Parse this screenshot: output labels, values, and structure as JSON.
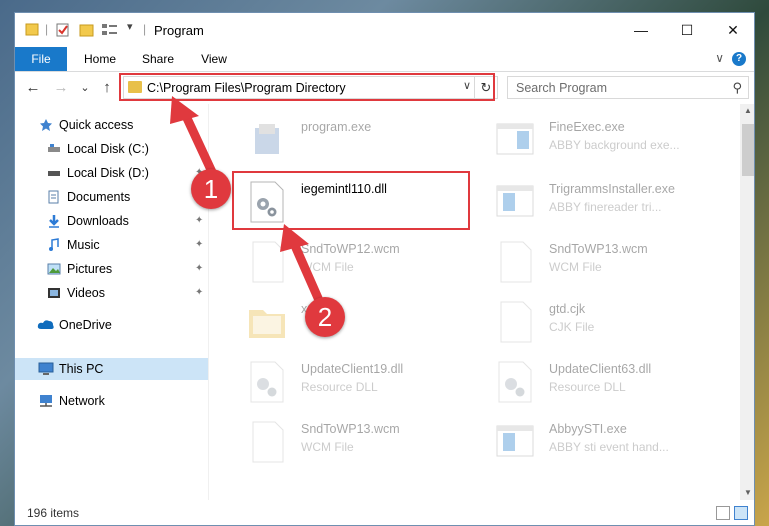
{
  "window": {
    "title": "Program",
    "minimize": "—",
    "maximize": "☐",
    "close": "✕"
  },
  "ribbon": {
    "tabs": [
      "File",
      "Home",
      "Share",
      "View"
    ],
    "help": "?",
    "collapse": "∨"
  },
  "nav": {
    "back": "←",
    "forward": "→",
    "recent": "⌄",
    "up": "↑",
    "address": "C:\\Program Files\\Program Directory",
    "address_dropdown": "∨",
    "refresh": "↻",
    "search_placeholder": "Search Program",
    "search_icon": "⚲"
  },
  "sidebar": {
    "items": [
      {
        "label": "Quick access",
        "icon": "star-icon",
        "pinned": false
      },
      {
        "label": "Local Disk (C:)",
        "icon": "drive-icon",
        "pinned": true
      },
      {
        "label": "Local Disk (D:)",
        "icon": "drive-icon",
        "pinned": true
      },
      {
        "label": "Documents",
        "icon": "documents-icon",
        "pinned": true
      },
      {
        "label": "Downloads",
        "icon": "downloads-icon",
        "pinned": true
      },
      {
        "label": "Music",
        "icon": "music-icon",
        "pinned": true
      },
      {
        "label": "Pictures",
        "icon": "pictures-icon",
        "pinned": true
      },
      {
        "label": "Videos",
        "icon": "videos-icon",
        "pinned": true
      },
      {
        "label": "OneDrive",
        "icon": "cloud-icon",
        "pinned": false
      },
      {
        "label": "This PC",
        "icon": "computer-icon",
        "pinned": false,
        "selected": true
      },
      {
        "label": "Network",
        "icon": "network-icon",
        "pinned": false
      }
    ],
    "pin_glyph": "📌"
  },
  "files": [
    {
      "name": "program.exe",
      "desc": "",
      "icon": "installer-icon"
    },
    {
      "name": "FineExec.exe",
      "desc": "ABBY background exe...",
      "icon": "app-window-icon"
    },
    {
      "name": "iegemintl110.dll",
      "desc": "",
      "icon": "dll-gear-icon",
      "highlighted": true
    },
    {
      "name": "TrigrammsInstaller.exe",
      "desc": "ABBY finereader tri...",
      "icon": "app-window-icon"
    },
    {
      "name": "SndToWP12.wcm",
      "desc": "WCM File",
      "icon": "blank-file-icon"
    },
    {
      "name": "SndToWP13.wcm",
      "desc": "WCM File",
      "icon": "blank-file-icon"
    },
    {
      "name": "x64",
      "desc": "",
      "icon": "folder-icon"
    },
    {
      "name": "gtd.cjk",
      "desc": "CJK File",
      "icon": "blank-file-icon"
    },
    {
      "name": "UpdateClient19.dll",
      "desc": "Resource DLL",
      "icon": "dll-gear-icon"
    },
    {
      "name": "UpdateClient63.dll",
      "desc": "Resource DLL",
      "icon": "dll-gear-icon"
    },
    {
      "name": "SndToWP13.wcm",
      "desc": "WCM File",
      "icon": "blank-file-icon"
    },
    {
      "name": "AbbyySTI.exe",
      "desc": "ABBY sti event hand...",
      "icon": "app-window-icon"
    }
  ],
  "status": {
    "count": "196 items"
  },
  "annotations": {
    "step1": "1",
    "step2": "2",
    "highlight_color": "#e0393e"
  },
  "colors": {
    "accent": "#1979ca",
    "selection": "#cce4f7"
  }
}
